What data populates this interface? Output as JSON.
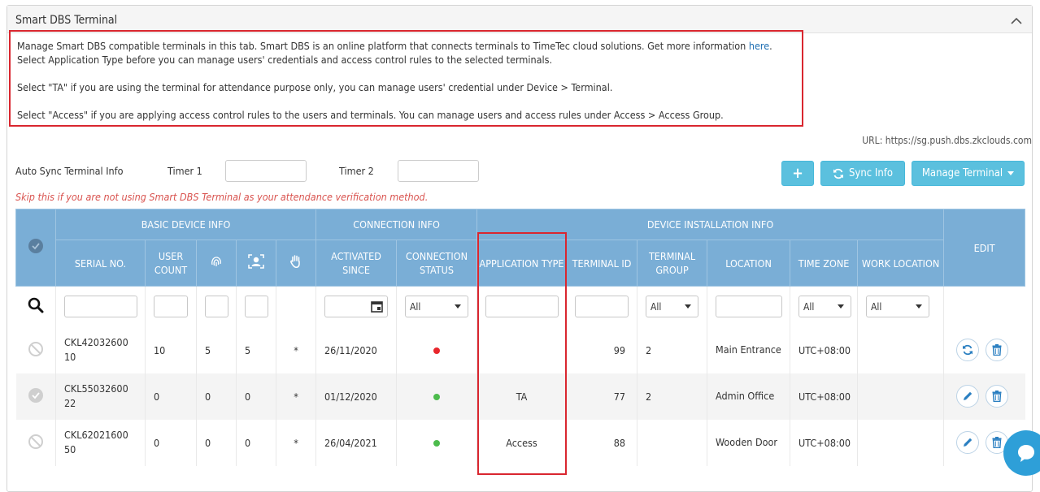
{
  "panel": {
    "title": "Smart DBS Terminal"
  },
  "info": {
    "line1": "Manage Smart DBS compatible terminals in this tab. Smart DBS is an online platform that connects terminals to TimeTec cloud solutions. Get more information ",
    "line1_link": "here",
    "line1_end": ".",
    "line2": "Select Application Type before you can manage users' credentials and access control rules to the selected terminals.",
    "line3": "Select \"TA\" if you are using the terminal for attendance purpose only, you can manage users' credential under Device > Terminal.",
    "line4": "Select \"Access\" if you are applying access control rules to the users and terminals. You can manage users and access rules under Access > Access Group."
  },
  "url": "URL: https://sg.push.dbs.zkclouds.com",
  "sync": {
    "auto_label": "Auto Sync Terminal Info",
    "timer1_label": "Timer 1",
    "timer2_label": "Timer 2",
    "timer1_value": "",
    "timer2_value": ""
  },
  "buttons": {
    "add": "+",
    "sync_info": "Sync Info",
    "manage_terminal": "Manage Terminal"
  },
  "skip_note": "Skip this if you are not using Smart DBS Terminal as your attendance verification method.",
  "table": {
    "groups": {
      "basic": "BASIC DEVICE INFO",
      "connection": "CONNECTION INFO",
      "installation": "DEVICE INSTALLATION INFO",
      "edit": "EDIT"
    },
    "columns": {
      "serial": "SERIAL NO.",
      "user_count": "USER COUNT",
      "activated": "ACTIVATED SINCE",
      "conn_status": "CONNECTION STATUS",
      "app_type": "APPLICATION TYPE",
      "terminal_id": "TERMINAL ID",
      "terminal_group": "TERMINAL GROUP",
      "location": "LOCATION",
      "time_zone": "TIME ZONE",
      "work_location": "WORK LOCATION"
    },
    "filters": {
      "conn_status": "All",
      "terminal_group": "All",
      "time_zone": "All",
      "work_location": "All"
    },
    "rows": [
      {
        "serial": "CKL4203260010",
        "user_count": "10",
        "fp": "5",
        "face": "5",
        "palm": "*",
        "activated": "26/11/2020",
        "status_color": "#e8262c",
        "app_type": "",
        "terminal_id": "99",
        "terminal_group": "2",
        "location": "Main Entrance",
        "time_zone": "UTC+08:00",
        "work_location": ""
      },
      {
        "serial": "CKL5503260022",
        "user_count": "0",
        "fp": "0",
        "face": "0",
        "palm": "*",
        "activated": "01/12/2020",
        "status_color": "#4cbb4c",
        "app_type": "TA",
        "terminal_id": "77",
        "terminal_group": "2",
        "location": "Admin Office",
        "time_zone": "UTC+08:00",
        "work_location": ""
      },
      {
        "serial": "CKL6202160050",
        "user_count": "0",
        "fp": "0",
        "face": "0",
        "palm": "*",
        "activated": "26/04/2021",
        "status_color": "#4cbb4c",
        "app_type": "Access",
        "terminal_id": "88",
        "terminal_group": "",
        "location": "Wooden Door",
        "time_zone": "UTC+08:00",
        "work_location": ""
      }
    ]
  },
  "colors": {
    "header_blue": "#7aaed6",
    "button_blue": "#5bc0de",
    "highlight_red": "#d9262f",
    "note_red": "#d9534f"
  },
  "icons": [
    "chevron-up-icon",
    "plus-icon",
    "sync-icon",
    "caret-down-icon",
    "fingerprint-icon",
    "face-icon",
    "palm-icon",
    "search-icon",
    "calendar-icon",
    "refresh-icon",
    "trash-icon",
    "pencil-icon",
    "ban-icon",
    "check-circle-icon",
    "chat-icon"
  ]
}
